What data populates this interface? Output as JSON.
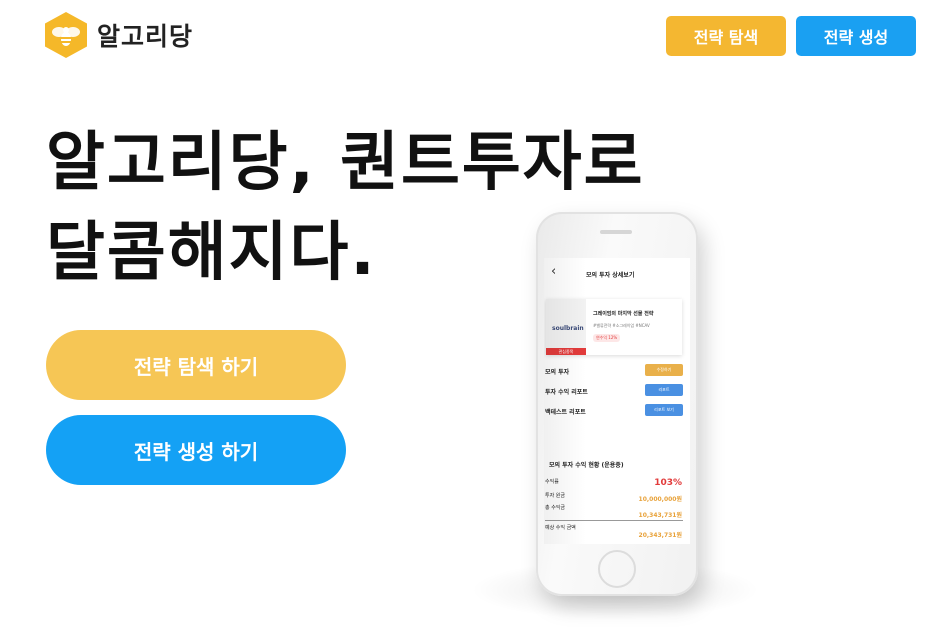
{
  "brand": {
    "name": "알고리당",
    "logo_icon": "bee-icon",
    "color": "#f5b829"
  },
  "header": {
    "explore_button": "전략 탐색",
    "create_button": "전략 생성"
  },
  "hero": {
    "title_line1": "알고리당, 퀀트투자로",
    "title_line2": "달콤해지다.",
    "explore_cta": "전략 탐색 하기",
    "create_cta": "전략 생성 하기"
  },
  "colors": {
    "yellow": "#f4b731",
    "blue": "#1aa0f2",
    "yellow_light": "#f6c655"
  },
  "phone_screen": {
    "back_icon": "chevron-left-icon",
    "title": "모의 투자 상세보기",
    "strategy_card": {
      "thumb_logo": "soulbrain",
      "thumb_tag": "관심종목",
      "title": "그레이엄의 마지막 선물 전략",
      "subtitle": "#밸류전략 #소그레이엄 #NCAV",
      "badge": "연수익 12%"
    },
    "rows": [
      {
        "label": "모의 투자",
        "button": "수정하기",
        "color": "#e9b04a"
      },
      {
        "label": "투자 수익 리포트",
        "button": "리포트",
        "color": "#4a90e2"
      },
      {
        "label": "백테스트 리포트",
        "button": "리포트 보기",
        "color": "#4a90e2"
      }
    ],
    "summary": {
      "title": "모의 투자 수익 현황 (운용중)",
      "yield_label": "수익률",
      "yield_value": "103%",
      "principal_label": "투자 원금",
      "principal_value": "10,000,000원",
      "total_label": "총 수익금",
      "total_value": "10,343,731원",
      "expected_label": "예상 수익 금액",
      "expected_value": "20,343,731원"
    }
  }
}
